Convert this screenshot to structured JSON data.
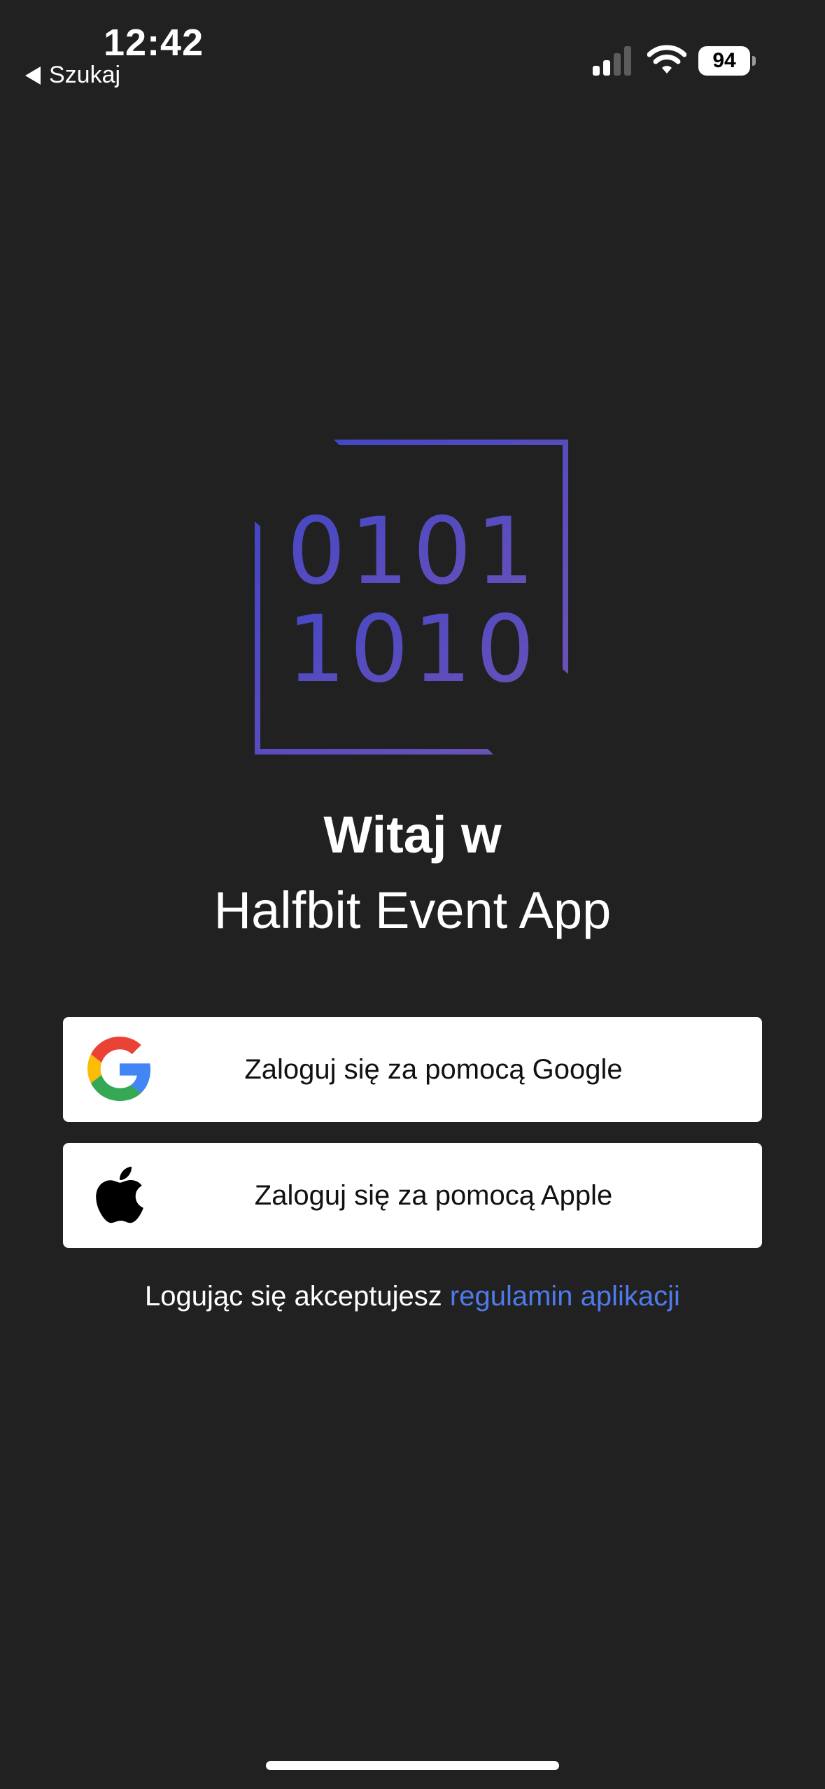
{
  "status_bar": {
    "time": "12:42",
    "back_label": "Szukaj",
    "battery_level": "94"
  },
  "logo": {
    "line1": "0101",
    "line2": "1010",
    "gradient_start": "#4447c4",
    "gradient_end": "#6a51b8"
  },
  "welcome": {
    "title": "Witaj w",
    "app_name": "Halfbit Event App"
  },
  "buttons": {
    "google_label": "Zaloguj się za pomocą Google",
    "apple_label": "Zaloguj się za pomocą Apple"
  },
  "terms": {
    "prefix": "Logując się akceptujesz",
    "link_label": "regulamin aplikacji",
    "link_color": "#4f7bea"
  },
  "icons": [
    "back-arrow-icon",
    "cellular-signal-icon",
    "wifi-icon",
    "battery-icon",
    "google-icon",
    "apple-icon"
  ]
}
